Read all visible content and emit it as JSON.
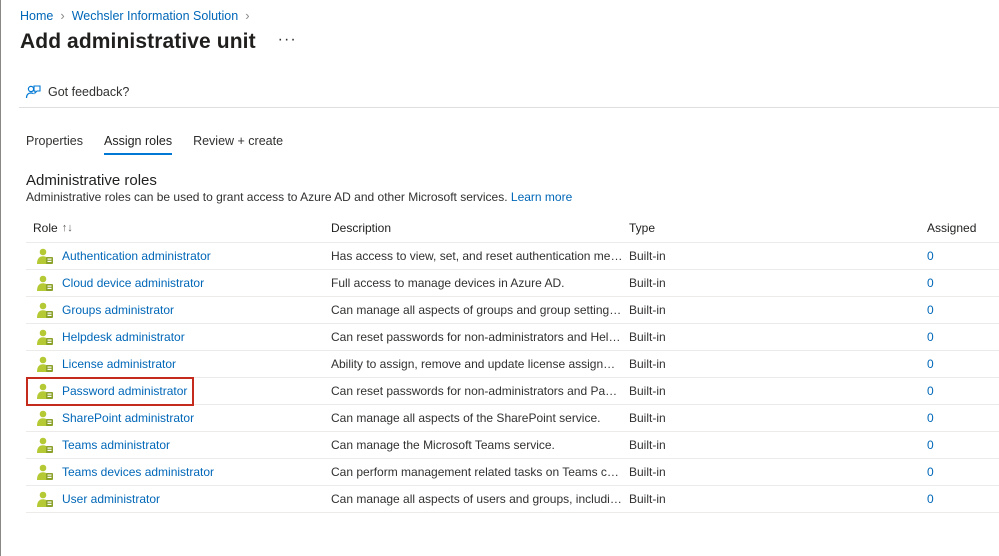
{
  "breadcrumb": {
    "items": [
      "Home",
      "Wechsler Information Solution"
    ]
  },
  "page": {
    "title": "Add administrative unit",
    "more_label": "···"
  },
  "toolbar": {
    "feedback_label": "Got feedback?"
  },
  "tabs": [
    {
      "label": "Properties",
      "active": false
    },
    {
      "label": "Assign roles",
      "active": true
    },
    {
      "label": "Review + create",
      "active": false
    }
  ],
  "section": {
    "title": "Administrative roles",
    "description": "Administrative roles can be used to grant access to Azure AD and other Microsoft services.",
    "learn_more": "Learn more"
  },
  "table": {
    "headers": {
      "role": "Role",
      "description": "Description",
      "type": "Type",
      "assigned": "Assigned"
    },
    "sort_icon": "↑↓",
    "rows": [
      {
        "role": "Authentication administrator",
        "description": "Has access to view, set, and reset authentication method ...",
        "type": "Built-in",
        "assigned": "0"
      },
      {
        "role": "Cloud device administrator",
        "description": "Full access to manage devices in Azure AD.",
        "type": "Built-in",
        "assigned": "0"
      },
      {
        "role": "Groups administrator",
        "description": "Can manage all aspects of groups and group settings lik...",
        "type": "Built-in",
        "assigned": "0"
      },
      {
        "role": "Helpdesk administrator",
        "description": "Can reset passwords for non-administrators and Helpde...",
        "type": "Built-in",
        "assigned": "0"
      },
      {
        "role": "License administrator",
        "description": "Ability to assign, remove and update license assignments.",
        "type": "Built-in",
        "assigned": "0"
      },
      {
        "role": "Password administrator",
        "description": "Can reset passwords for non-administrators and Passwo...",
        "type": "Built-in",
        "assigned": "0",
        "highlighted": true
      },
      {
        "role": "SharePoint administrator",
        "description": "Can manage all aspects of the SharePoint service.",
        "type": "Built-in",
        "assigned": "0"
      },
      {
        "role": "Teams administrator",
        "description": "Can manage the Microsoft Teams service.",
        "type": "Built-in",
        "assigned": "0"
      },
      {
        "role": "Teams devices administrator",
        "description": "Can perform management related tasks on Teams certifie...",
        "type": "Built-in",
        "assigned": "0"
      },
      {
        "role": "User administrator",
        "description": "Can manage all aspects of users and groups, including r...",
        "type": "Built-in",
        "assigned": "0"
      }
    ]
  },
  "icons": {
    "feedback": "feedback-icon",
    "role": "admin-role-icon"
  },
  "colors": {
    "link": "#0067b8",
    "accent": "#0078d4",
    "highlight_border": "#c42b1c",
    "icon_person": "#b4c934",
    "icon_badge": "#8aa12a"
  }
}
